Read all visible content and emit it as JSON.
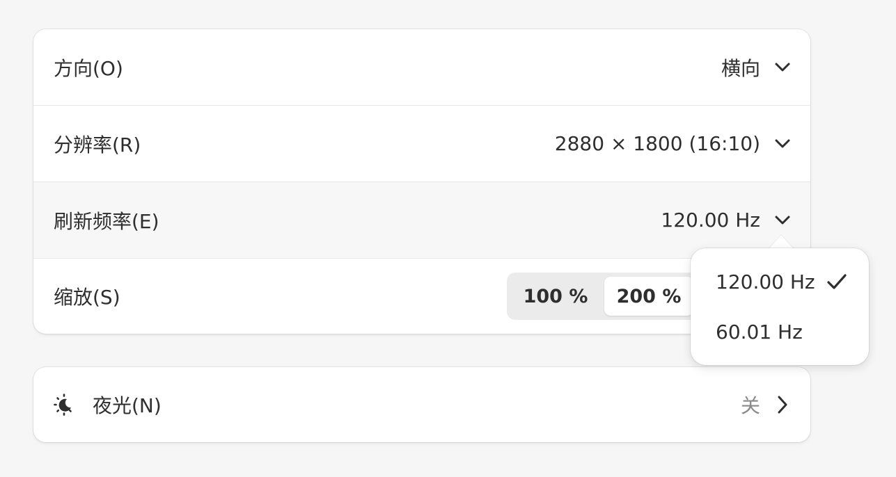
{
  "display": {
    "orientation": {
      "label": "方向(O)",
      "value": "横向"
    },
    "resolution": {
      "label": "分辨率(R)",
      "value": "2880 × 1800 (16:10)"
    },
    "refresh_rate": {
      "label": "刷新频率(E)",
      "value": "120.00 Hz"
    },
    "scale": {
      "label": "缩放(S)",
      "options": [
        "100 %",
        "200 %"
      ],
      "selected": "200 %"
    }
  },
  "night_light": {
    "label": "夜光(N)",
    "value": "关",
    "icon": "night-light-icon"
  },
  "refresh_popover": {
    "items": [
      {
        "label": "120.00 Hz",
        "checked": true
      },
      {
        "label": "60.01 Hz",
        "checked": false
      }
    ]
  },
  "icons": {
    "dropdown": "chevron-down-icon",
    "navigate": "chevron-right-icon",
    "check": "checkmark-icon"
  }
}
